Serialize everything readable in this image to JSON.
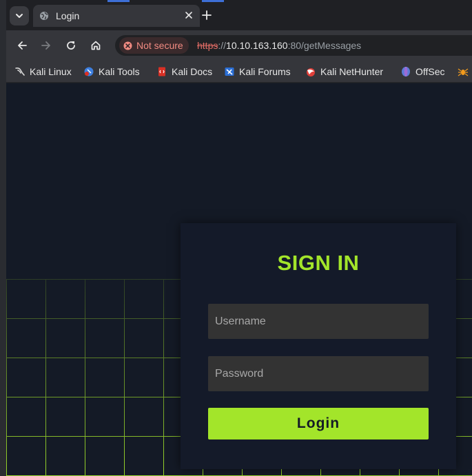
{
  "browser": {
    "tab": {
      "title": "Login"
    },
    "security": {
      "label": "Not secure"
    },
    "url": {
      "scheme": "https",
      "sep": "://",
      "host": "10.10.163.160",
      "rest": ":80/getMessages"
    },
    "bookmarks": [
      {
        "label": "Kali Linux",
        "icon": "kali-dragon-icon",
        "color": "#d9d9d9"
      },
      {
        "label": "Kali Tools",
        "icon": "kali-tools-icon",
        "color": "#3d7fe0"
      },
      {
        "label": "Kali Docs",
        "icon": "kali-docs-icon",
        "color": "#d93025"
      },
      {
        "label": "Kali Forums",
        "icon": "kali-forums-icon",
        "color": "#2b6fd6"
      },
      {
        "label": "Kali NetHunter",
        "icon": "kali-nethunter-icon",
        "color": "#e0403a"
      },
      {
        "label": "OffSec",
        "icon": "offsec-icon",
        "color": "#5b7bd8"
      },
      {
        "label": "",
        "icon": "exploit-db-icon",
        "color": "#f29b1d"
      }
    ]
  },
  "page": {
    "heading": "SIGN IN",
    "username_placeholder": "Username",
    "password_placeholder": "Password",
    "login_label": "Login"
  },
  "colors": {
    "accent": "#a3e52a",
    "page_background": "#141a26",
    "card_background": "#141a29",
    "input_background": "#333333"
  }
}
